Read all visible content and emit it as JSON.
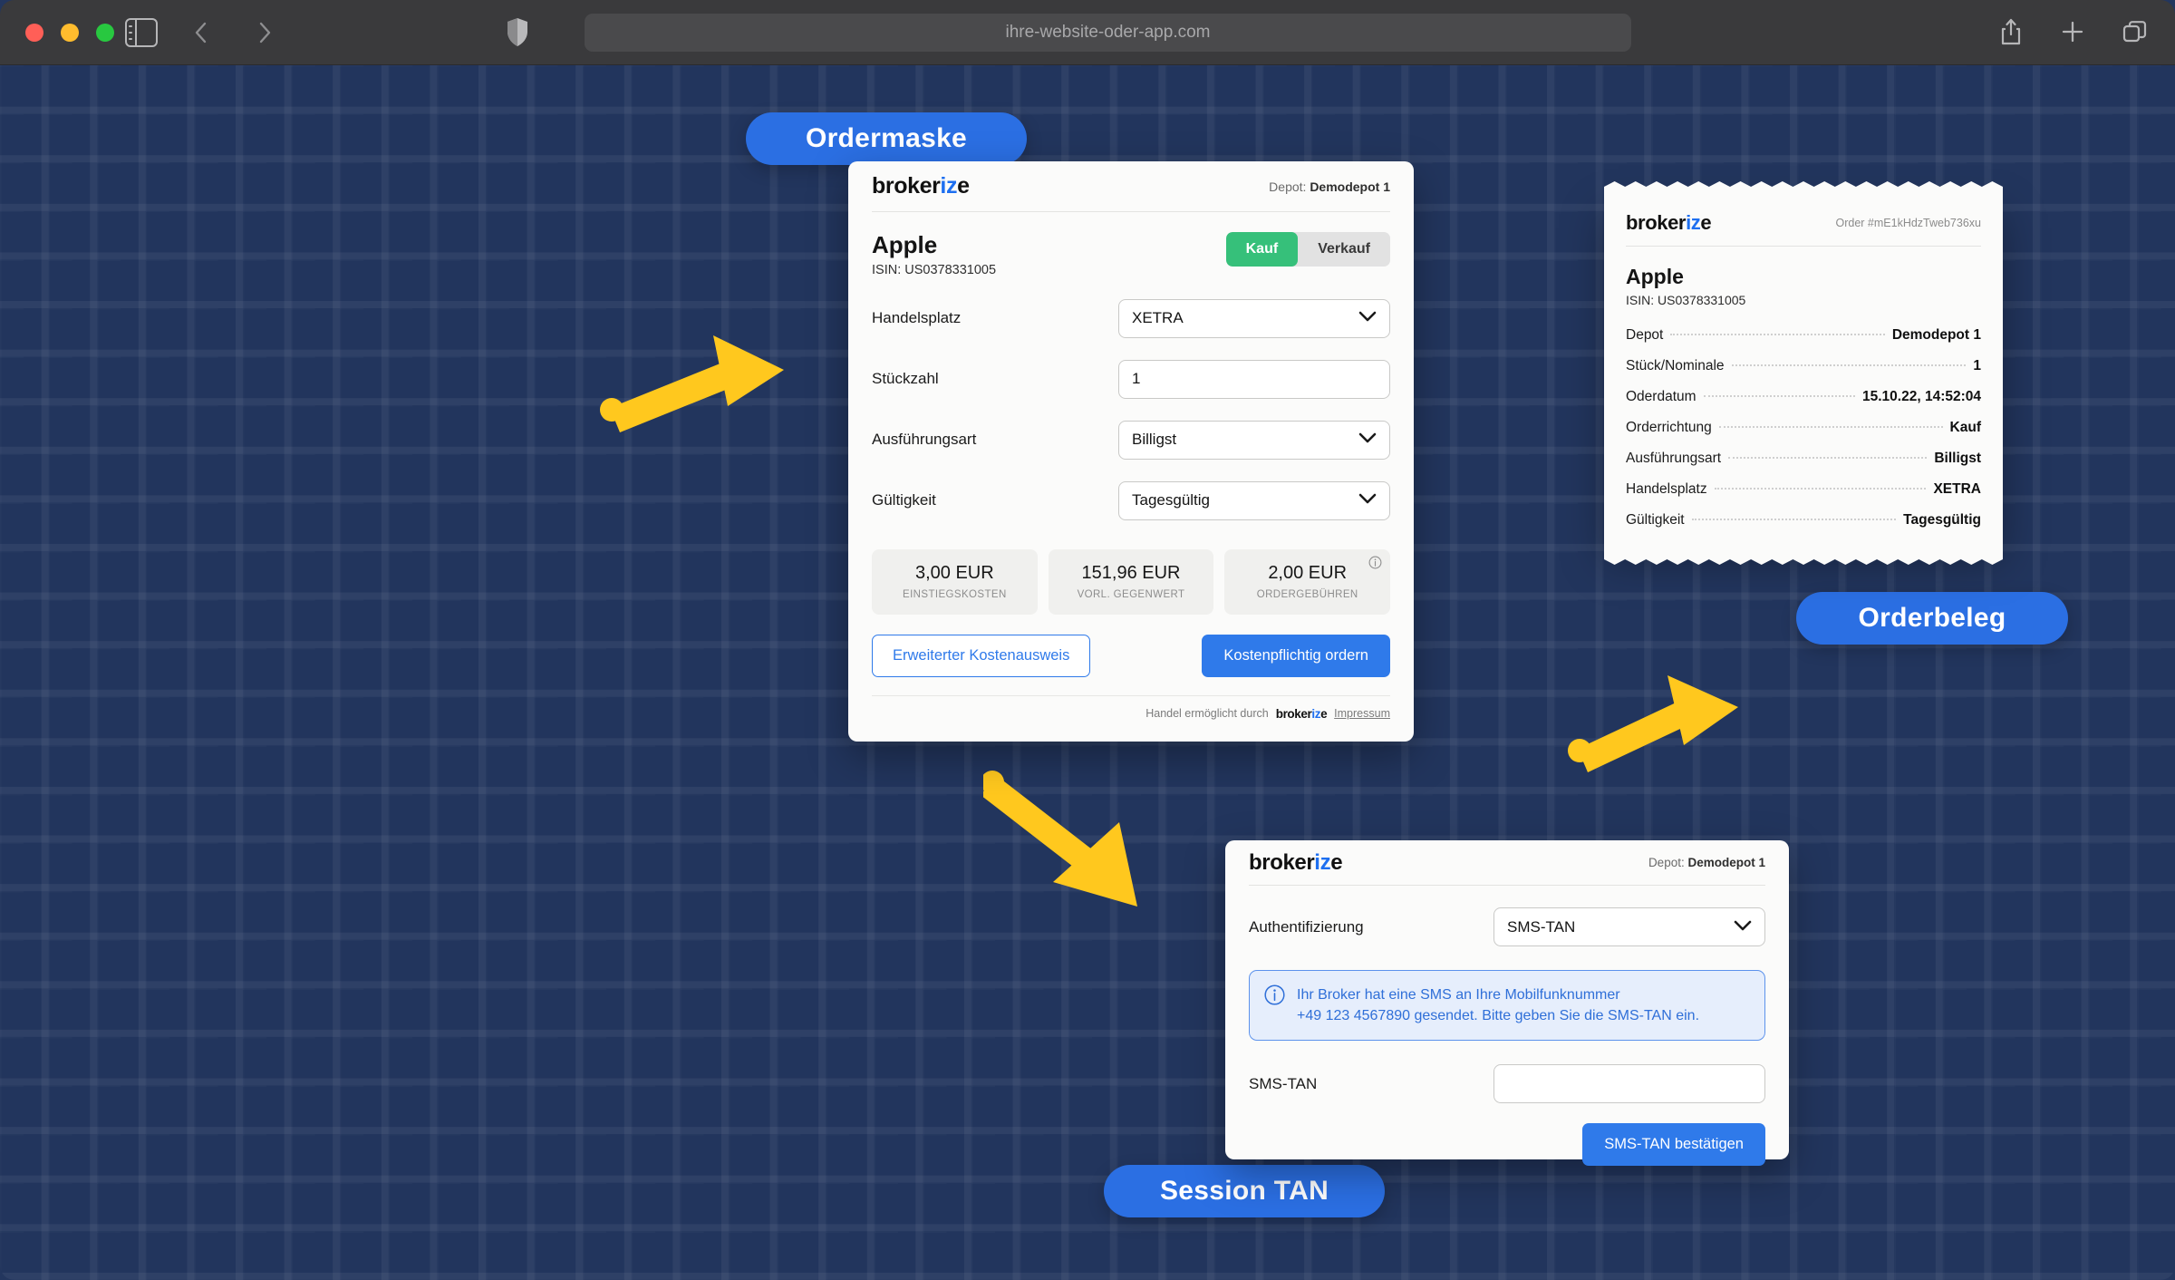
{
  "browser": {
    "url": "ihre-website-oder-app.com",
    "icons": {
      "sidebar": "sidebar-toggle-icon",
      "back": "back-arrow-icon",
      "forward": "forward-arrow-icon",
      "shield": "shield-icon",
      "share": "share-icon",
      "new_tab": "plus-icon",
      "tabs": "tab-overview-icon"
    }
  },
  "callouts": {
    "ordermaske": "Ordermaske",
    "orderbeleg": "Orderbeleg",
    "session_tan": "Session TAN"
  },
  "order_form": {
    "logo": {
      "part1": "broker",
      "part_i": "i",
      "part_z": "z",
      "part_e": "e"
    },
    "depot_label": "Depot:",
    "depot_value": "Demodepot 1",
    "instrument": "Apple",
    "isin": "ISIN: US0378331005",
    "toggle": {
      "buy": "Kauf",
      "sell": "Verkauf",
      "selected": "Kauf"
    },
    "fields": [
      {
        "label": "Handelsplatz",
        "value": "XETRA",
        "type": "select"
      },
      {
        "label": "Stückzahl",
        "value": "1",
        "type": "input"
      },
      {
        "label": "Ausführungsart",
        "value": "Billigst",
        "type": "select"
      },
      {
        "label": "Gültigkeit",
        "value": "Tagesgültig",
        "type": "select"
      }
    ],
    "costs": [
      {
        "value": "3,00 EUR",
        "label": "EINSTIEGSKOSTEN"
      },
      {
        "value": "151,96 EUR",
        "label": "VORL. GEGENWERT"
      },
      {
        "value": "2,00 EUR",
        "label": "ORDERGEBÜHREN"
      }
    ],
    "secondary_button": "Erweiterter Kostenausweis",
    "primary_button": "Kostenpflichtig ordern",
    "footer_text": "Handel ermöglicht durch",
    "footer_link": "Impressum"
  },
  "receipt": {
    "order_id": "Order #mE1kHdzTweb736xu",
    "instrument": "Apple",
    "isin": "ISIN: US0378331005",
    "rows": [
      {
        "key": "Depot",
        "value": "Demodepot 1"
      },
      {
        "key": "Stück/Nominale",
        "value": "1"
      },
      {
        "key": "Oderdatum",
        "value": "15.10.22, 14:52:04"
      },
      {
        "key": "Orderrichtung",
        "value": "Kauf"
      },
      {
        "key": "Ausführungsart",
        "value": "Billigst"
      },
      {
        "key": "Handelsplatz",
        "value": "XETRA"
      },
      {
        "key": "Gültigkeit",
        "value": "Tagesgültig"
      }
    ]
  },
  "tan_card": {
    "depot_label": "Depot:",
    "depot_value": "Demodepot 1",
    "auth_label": "Authentifizierung",
    "auth_value": "SMS-TAN",
    "info_line1": "Ihr Broker hat eine SMS an Ihre Mobilfunknummer",
    "info_line2": "+49 123 4567890 gesendet. Bitte geben Sie die SMS-TAN ein.",
    "tan_label": "SMS-TAN",
    "tan_value": "",
    "confirm_button": "SMS-TAN bestätigen"
  },
  "colors": {
    "background": "#22355d",
    "accent_blue": "#2f7aea",
    "pill_blue": "#2b6fe3",
    "buy_green": "#36c07a",
    "arrow_yellow": "#ffc81e",
    "card_bg": "#fbfbfa"
  }
}
